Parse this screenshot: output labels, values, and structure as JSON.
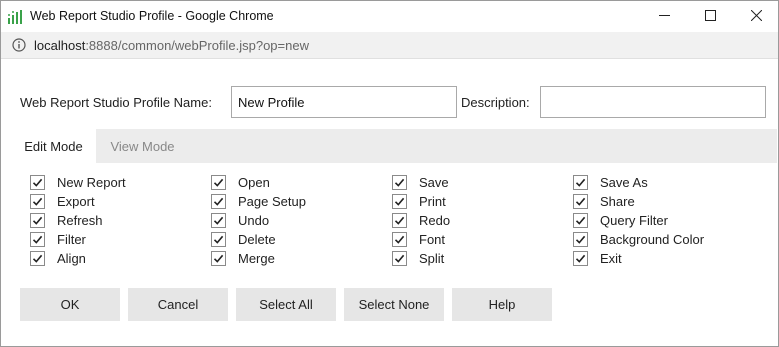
{
  "window": {
    "title": "Web Report Studio Profile - Google Chrome"
  },
  "address": {
    "host": "localhost",
    "rest": ":8888/common/webProfile.jsp?op=new"
  },
  "form": {
    "name_label": "Web Report Studio Profile Name:",
    "name_value": "New Profile",
    "desc_label": "Description:",
    "desc_value": ""
  },
  "tabs": [
    {
      "label": "Edit Mode",
      "active": true
    },
    {
      "label": "View Mode",
      "active": false
    }
  ],
  "options": [
    [
      {
        "label": "New Report",
        "checked": true
      },
      {
        "label": "Export",
        "checked": true
      },
      {
        "label": "Refresh",
        "checked": true
      },
      {
        "label": "Filter",
        "checked": true
      },
      {
        "label": "Align",
        "checked": true
      }
    ],
    [
      {
        "label": "Open",
        "checked": true
      },
      {
        "label": "Page Setup",
        "checked": true
      },
      {
        "label": "Undo",
        "checked": true
      },
      {
        "label": "Delete",
        "checked": true
      },
      {
        "label": "Merge",
        "checked": true
      }
    ],
    [
      {
        "label": "Save",
        "checked": true
      },
      {
        "label": "Print",
        "checked": true
      },
      {
        "label": "Redo",
        "checked": true
      },
      {
        "label": "Font",
        "checked": true
      },
      {
        "label": "Split",
        "checked": true
      }
    ],
    [
      {
        "label": "Save As",
        "checked": true
      },
      {
        "label": "Share",
        "checked": true
      },
      {
        "label": "Query Filter",
        "checked": true
      },
      {
        "label": "Background Color",
        "checked": true
      },
      {
        "label": "Exit",
        "checked": true
      }
    ]
  ],
  "buttons": {
    "ok": "OK",
    "cancel": "Cancel",
    "select_all": "Select All",
    "select_none": "Select None",
    "help": "Help"
  },
  "colors": {
    "app_icon": "#3aa24a",
    "button_bg": "#e6e6e6",
    "tabbar_bg": "#ececec"
  }
}
